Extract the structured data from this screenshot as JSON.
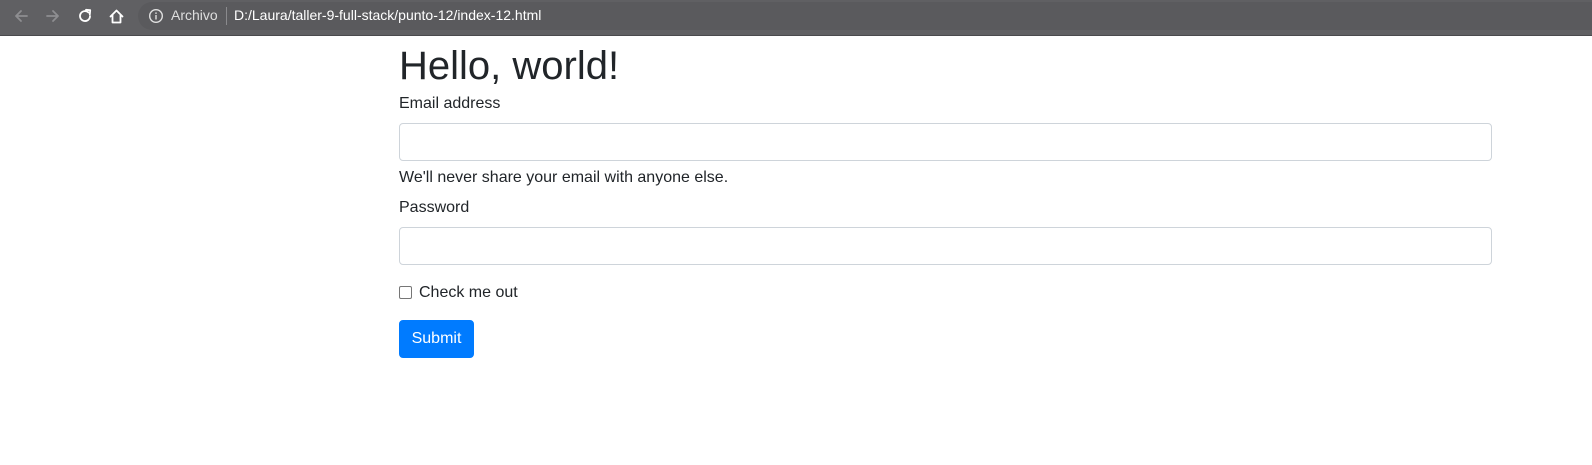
{
  "browser": {
    "origin_label": "Archivo",
    "url": "D:/Laura/taller-9-full-stack/punto-12/index-12.html",
    "toolbar_color": "#606063",
    "icons": [
      "back-arrow-icon",
      "forward-arrow-icon",
      "reload-icon",
      "home-icon",
      "info-icon"
    ]
  },
  "page": {
    "title": "Hello, world!",
    "form": {
      "email_label": "Email address",
      "email_value": "",
      "email_help": "We'll never share your email with anyone else.",
      "password_label": "Password",
      "password_value": "",
      "checkbox_label": "Check me out",
      "checkbox_checked": false,
      "submit_label": "Submit",
      "submit_color": "#007bff"
    }
  }
}
